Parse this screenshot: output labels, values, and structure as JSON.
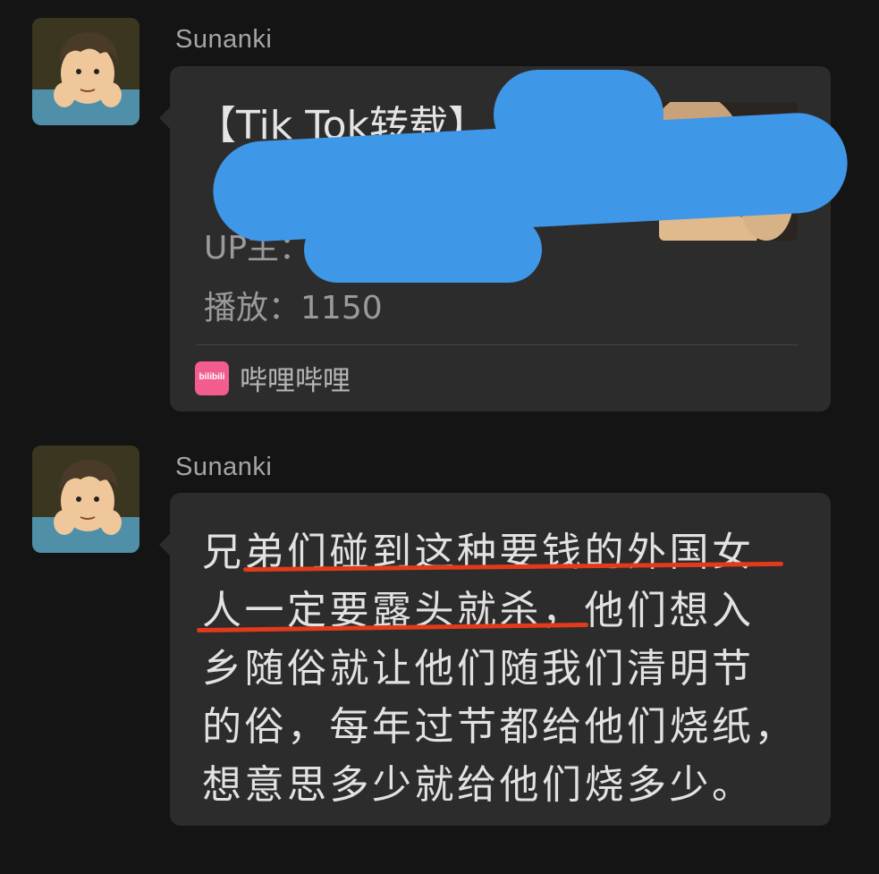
{
  "messages": [
    {
      "sender": "Sunanki",
      "type": "link-card",
      "card": {
        "title_line1": "【Tik Tok转载】",
        "title_line2": "",
        "uploader_label": "UP主：",
        "plays_label": "播放：",
        "plays_value": "1150",
        "source_name": "哔哩哔哩",
        "source_icon_text": "bilibili"
      }
    },
    {
      "sender": "Sunanki",
      "type": "text",
      "lines": [
        "兄弟们碰到这种要钱的外国女",
        "人一定要露头就杀，他们想入",
        "乡随俗就让他们随我们清明节",
        "的俗，每年过节都给他们烧纸，",
        "想意思多少就给他们烧多少。"
      ]
    }
  ],
  "colors": {
    "background": "#141414",
    "bubble": "#2c2c2c",
    "redaction": "#3f97e8",
    "underline": "#e23a1a",
    "bilibili_pink": "#f25d8e"
  }
}
